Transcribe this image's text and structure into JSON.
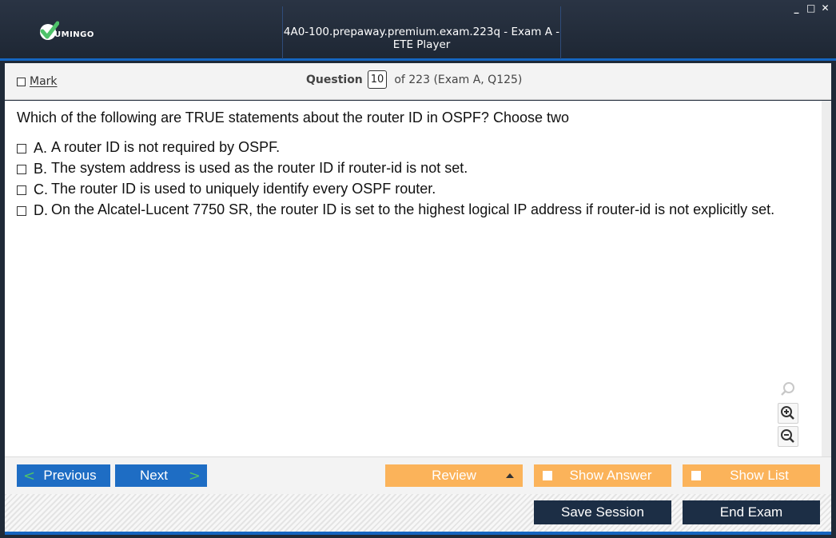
{
  "window": {
    "title": "4A0-100.prepaway.premium.exam.223q - Exam A - ETE Player",
    "logo_text": "UMINGO",
    "controls": [
      "_",
      "□",
      "✕"
    ]
  },
  "question_bar": {
    "mark_label": "Mark",
    "question_label": "Question",
    "question_number": "10",
    "question_of": "of 223 (Exam A, Q125)"
  },
  "question": {
    "text": "Which of the following are TRUE statements about the router ID in OSPF? Choose two",
    "options": [
      {
        "letter": "A.",
        "text": "A router ID is not required by OSPF."
      },
      {
        "letter": "B.",
        "text": "The system address is used as the router ID if router-id is not set."
      },
      {
        "letter": "C.",
        "text": "The router ID is used to uniquely identify every OSPF router."
      },
      {
        "letter": "D.",
        "text": "On the Alcatel-Lucent 7750 SR, the router ID is set to the highest logical IP address if router-id is not explicitly set."
      }
    ]
  },
  "zoom": {
    "icons": [
      "search-icon",
      "zoom-in-icon",
      "zoom-out-icon"
    ]
  },
  "nav": {
    "previous_label": "Previous",
    "next_label": "Next",
    "review_label": "Review",
    "show_answer_label": "Show Answer",
    "show_list_label": "Show List"
  },
  "footer": {
    "save_label": "Save Session",
    "end_label": "End Exam"
  },
  "colors": {
    "titlebar": "#1e2734",
    "accent_blue": "#1e6dc4",
    "orange": "#fbb35a",
    "dark_button": "#1c2e45",
    "logo_green": "#4fc26a"
  }
}
